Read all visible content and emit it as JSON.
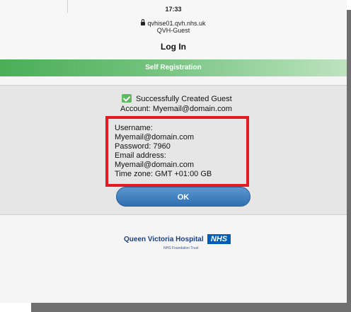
{
  "status_bar": {
    "time": "17:33",
    "url": "qvhise01.qvh.nhs.uk",
    "subtitle": "QVH-Guest"
  },
  "header": {
    "title": "Log In",
    "banner": "Self Registration"
  },
  "result": {
    "line1": "Successfully Created Guest",
    "line2": "Account: Myemail@domain.com"
  },
  "details": {
    "username_label": "Username:",
    "username_value": "Myemail@domain.com",
    "password": "Password: 7960",
    "email_label": "Email address:",
    "email_value": "Myemail@domain.com",
    "timezone": "Time zone: GMT +01:00 GB"
  },
  "ok_button": {
    "label": "OK"
  },
  "footer": {
    "hospital": "Queen Victoria Hospital",
    "nhs": "NHS",
    "trust": "NHS Foundation Trust"
  },
  "colors": {
    "green_bar": "#4aae57",
    "highlight_box": "#e51b23",
    "ok_button": "#2f6fb1",
    "nhs_blue": "#005eb8"
  },
  "icons": [
    "lock-icon",
    "checkmark-icon"
  ]
}
